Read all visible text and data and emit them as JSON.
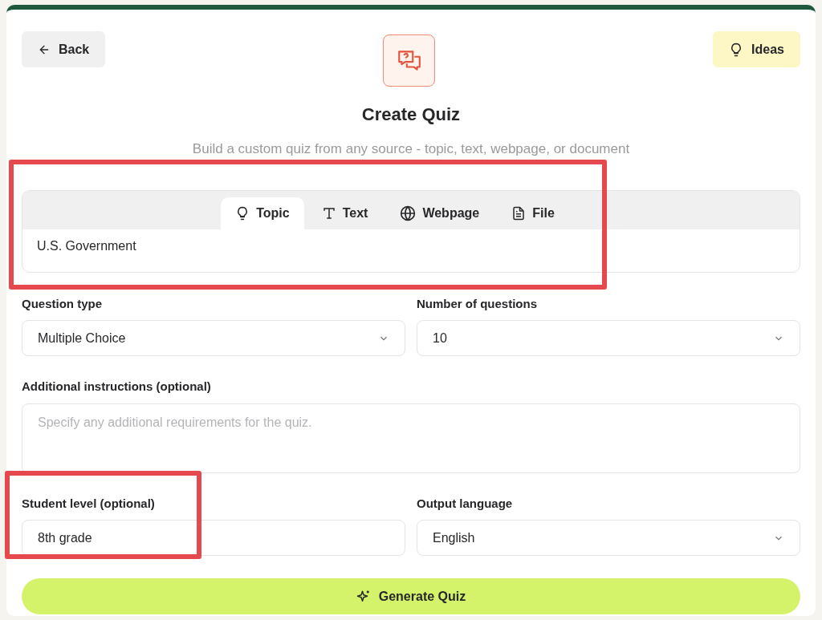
{
  "header": {
    "back_button": "Back",
    "ideas_button": "Ideas",
    "title": "Create Quiz",
    "subtitle": "Build a custom quiz from any source - topic, text, webpage, or document"
  },
  "source": {
    "tabs": [
      {
        "kind": "topic",
        "label": "Topic",
        "selected": true
      },
      {
        "kind": "text",
        "label": "Text",
        "selected": false
      },
      {
        "kind": "webpage",
        "label": "Webpage",
        "selected": false
      },
      {
        "kind": "file",
        "label": "File",
        "selected": false
      }
    ],
    "value": "U.S. Government",
    "highlighted": true
  },
  "question_type": {
    "label": "Question type",
    "value": "Multiple Choice"
  },
  "number_of_questions": {
    "label": "Number of questions",
    "value": "10"
  },
  "additional_instructions": {
    "label": "Additional instructions (optional)",
    "placeholder": "Specify any additional requirements for the quiz."
  },
  "student_level": {
    "label": "Student level (optional)",
    "value": "8th grade",
    "highlighted": true
  },
  "output_language": {
    "label": "Output language",
    "value": "English"
  },
  "generate_button": "Generate Quiz"
}
